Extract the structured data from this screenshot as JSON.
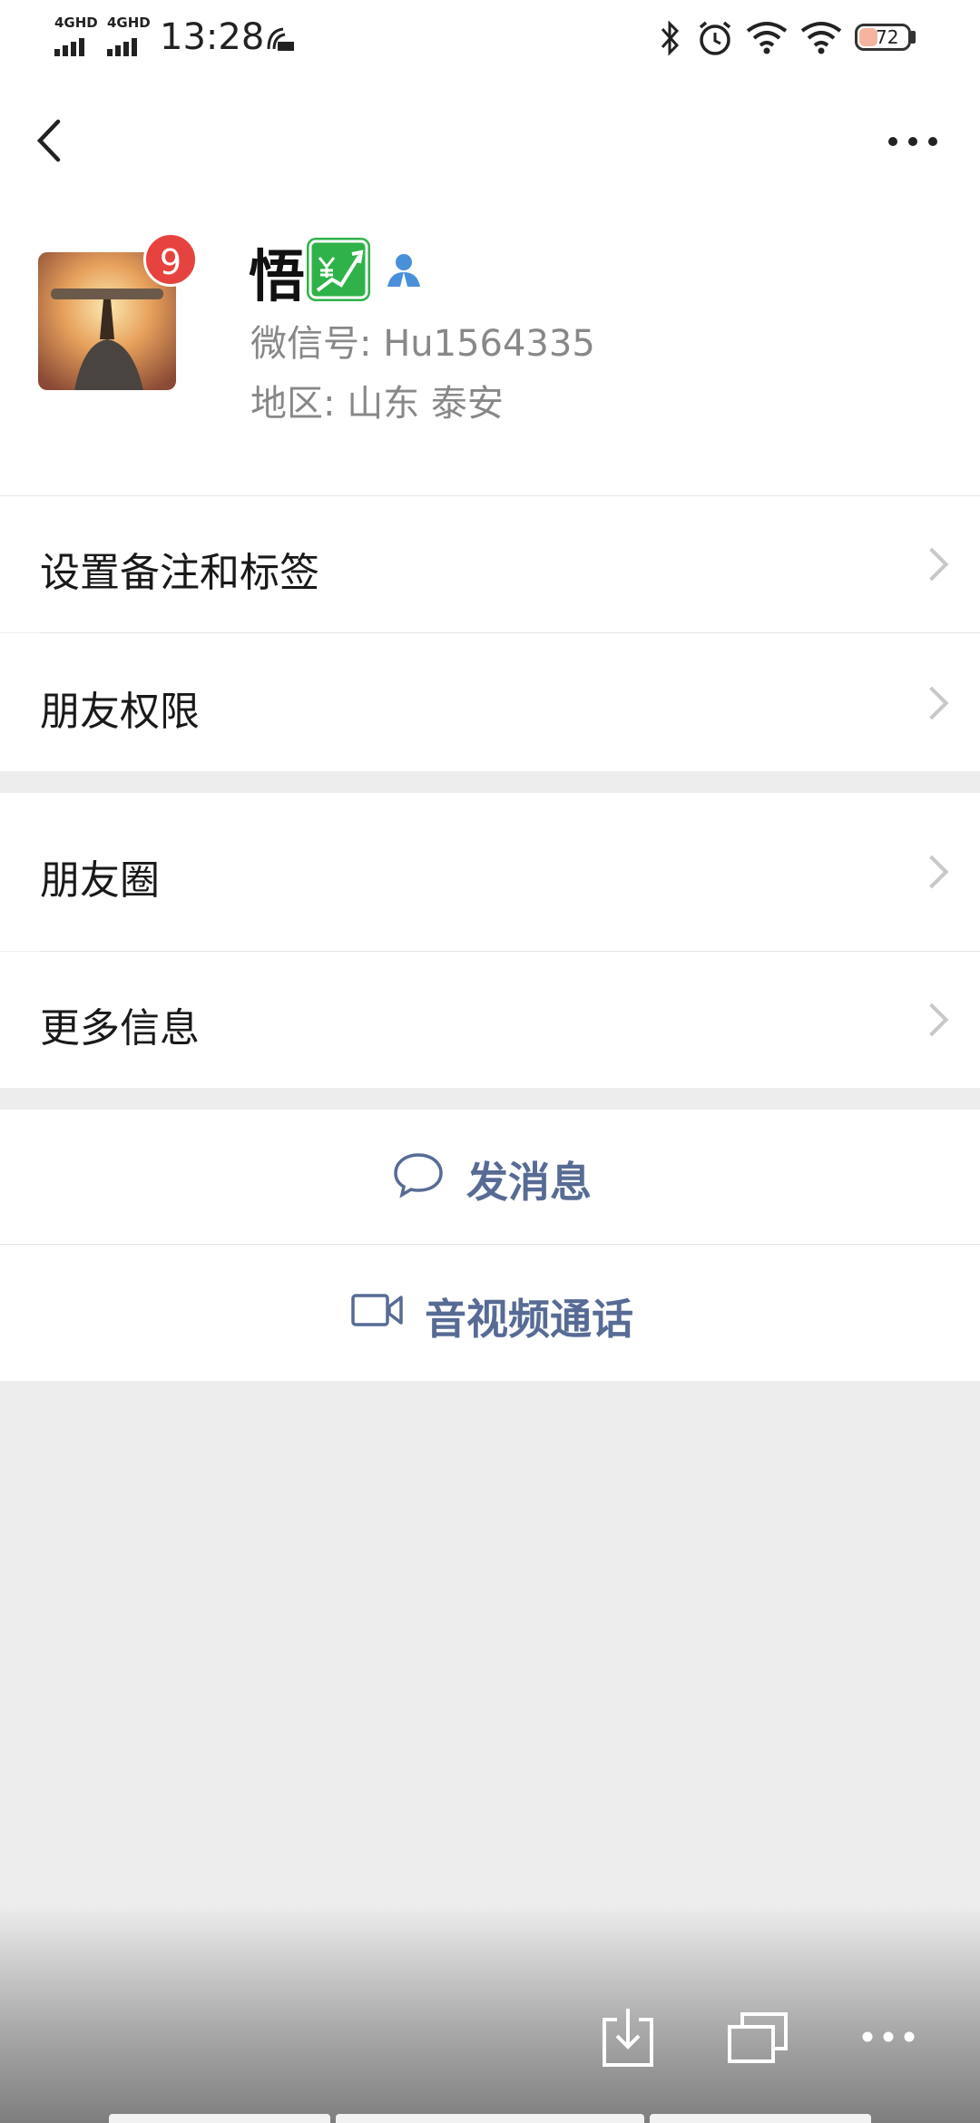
{
  "status_bar": {
    "network_1": "4GHD",
    "network_2": "4GHD",
    "time": "13:28",
    "battery": "72"
  },
  "profile": {
    "badge_count": "9",
    "nickname": "悟",
    "wechat_id": "微信号: Hu1564335",
    "region": "地区: 山东  泰安"
  },
  "menu": {
    "remark_tags": "设置备注和标签",
    "friend_permissions": "朋友权限",
    "moments": "朋友圈",
    "more_info": "更多信息"
  },
  "actions": {
    "send_message": "发消息",
    "video_call": "音视频通话"
  },
  "colors": {
    "accent_link": "#576b95",
    "badge_red": "#e64340",
    "background": "#ededed"
  },
  "icons": [
    "back-arrow-icon",
    "more-icon",
    "stock-up-icon",
    "contact-card-icon",
    "chat-bubble-icon",
    "video-camera-icon",
    "download-icon",
    "windows-icon",
    "more-dots-icon"
  ]
}
